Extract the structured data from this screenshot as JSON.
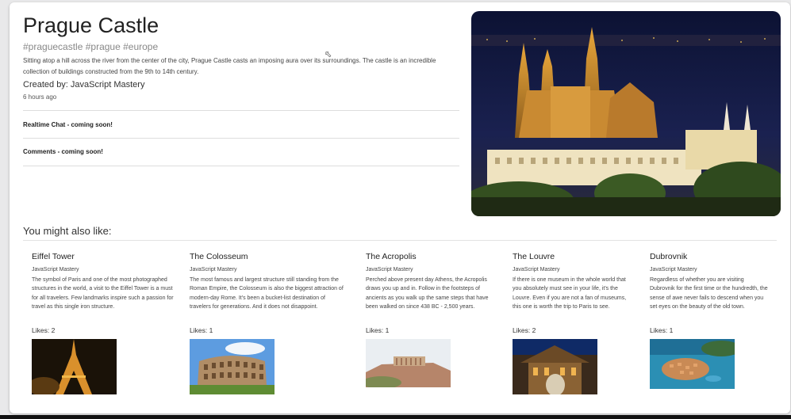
{
  "post": {
    "title": "Prague Castle",
    "tags": "#praguecastle #prague #europe",
    "message": "Sitting atop a hill across the river from the center of the city, Prague Castle casts an imposing aura over its surroundings. The castle is an incredible collection of buildings constructed from the 9th to 14th century.",
    "creator": "Created by: JavaScript Mastery",
    "time": "6 hours ago",
    "chat_label": "Realtime Chat - coming soon!",
    "comments_label": "Comments - coming soon!"
  },
  "recommended": {
    "heading": "You might also like:",
    "items": [
      {
        "title": "Eiffel Tower",
        "author": "JavaScript Mastery",
        "message": "The symbol of Paris and one of the most photographed structures in the world, a visit to the Eiffel Tower is a must for all travelers. Few landmarks inspire such a passion for travel as this single iron structure.",
        "likes": "Likes: 2"
      },
      {
        "title": "The Colosseum",
        "author": "JavaScript Mastery",
        "message": "The most famous and largest structure still standing from the Roman Empire, the Colosseum is also the biggest attraction of modern-day Rome. It's been a bucket-list destination of travelers for generations. And it does not disappoint.",
        "likes": "Likes: 1"
      },
      {
        "title": "The Acropolis",
        "author": "JavaScript Mastery",
        "message": "Perched above present day Athens, the Acropolis draws you up and in. Follow in the footsteps of ancients as you walk up the same steps that have been walked on since 438 BC - 2,500 years.",
        "likes": "Likes: 1"
      },
      {
        "title": "The Louvre",
        "author": "JavaScript Mastery",
        "message": "If there is one museum in the whole world that you absolutely must see in your life, it's the Louvre. Even if you are not a fan of museums, this one is worth the trip to Paris to see.",
        "likes": "Likes: 2"
      },
      {
        "title": "Dubrovnik",
        "author": "JavaScript Mastery",
        "message": "Regardless of whether you are visiting Dubrovnik for the first time or the hundredth, the sense of awe never fails to descend when you set eyes on the beauty of the old town.",
        "likes": "Likes: 1"
      }
    ]
  }
}
